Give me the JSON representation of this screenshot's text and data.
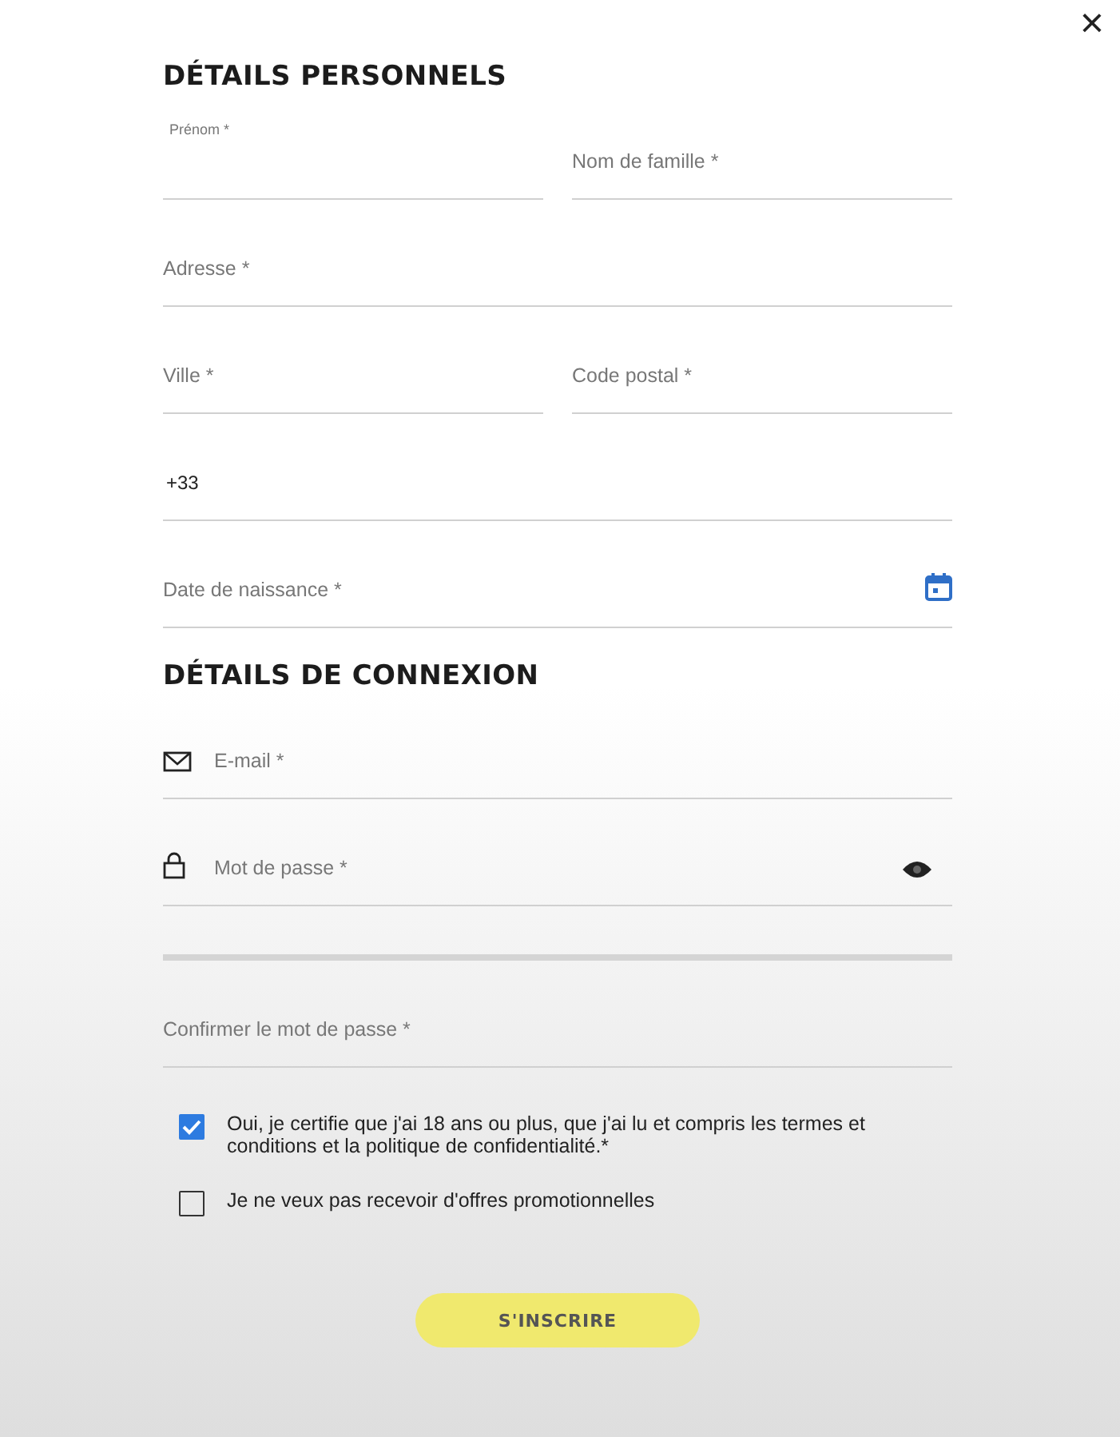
{
  "close_label": "×",
  "sections": [
    {
      "title": "DÉTAILS PERSONNELS",
      "rows": [
        {
          "fields": [
            {
              "label": "Prénom *",
              "floating": true
            },
            {
              "label": "Nom de famille *"
            }
          ]
        },
        {
          "fields": [
            {
              "label": "Adresse *"
            }
          ]
        },
        {
          "fields": [
            {
              "label": "Ville *"
            },
            {
              "label": "Code postal *"
            }
          ]
        },
        {
          "fields": [
            {
              "value": "+33"
            }
          ]
        },
        {
          "fields": [
            {
              "label": "Date de naissance *",
              "kind": "date"
            }
          ]
        }
      ]
    },
    {
      "title": "DÉTAILS DE CONNEXION",
      "rows": [
        {
          "fields": [
            {
              "label": "E-mail *",
              "kind": "email"
            }
          ]
        },
        {
          "fields": [
            {
              "label": "Mot de passe *",
              "kind": "password"
            }
          ]
        },
        {
          "fields": [
            {
              "label": "Confirmer le mot de passe *"
            }
          ],
          "divider_above": true
        }
      ]
    }
  ],
  "checkboxes": [
    {
      "label": "Oui, je certifie que j'ai 18 ans ou plus, que j'ai lu et compris les termes et conditions et la politique de confidentialité.*",
      "checked": true
    },
    {
      "label": "Je ne veux pas recevoir d'offres promotionnelles",
      "checked": false
    }
  ],
  "submit": "S'INSCRIRE"
}
